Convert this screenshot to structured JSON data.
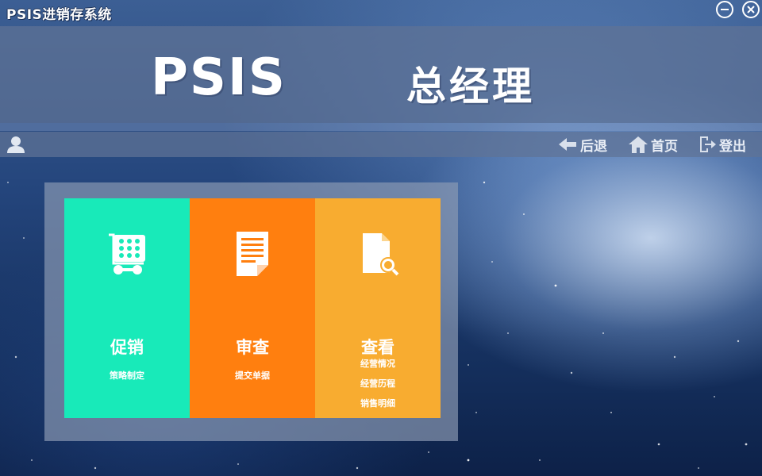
{
  "window": {
    "title": "PSIS进销存系统",
    "minimize_icon": "minus-circle-icon",
    "close_icon": "x-circle-icon"
  },
  "banner": {
    "brand": "PSIS",
    "role": "总经理"
  },
  "nav": {
    "user_icon": "user-icon",
    "back_label": "后退",
    "back_icon": "arrow-left-icon",
    "home_label": "首页",
    "home_icon": "house-icon",
    "logout_label": "登出",
    "logout_icon": "exit-icon"
  },
  "tiles": [
    {
      "title": "促销",
      "subs": [
        "策略制定"
      ],
      "color": "#18eab9",
      "icon": "cart-icon"
    },
    {
      "title": "审查",
      "subs": [
        "提交单据"
      ],
      "color": "#ff7f0f",
      "icon": "document-icon"
    },
    {
      "title": "查看",
      "subs": [
        "经营情况",
        "经营历程",
        "销售明细"
      ],
      "color": "#f8ac30",
      "icon": "file-search-icon"
    }
  ]
}
